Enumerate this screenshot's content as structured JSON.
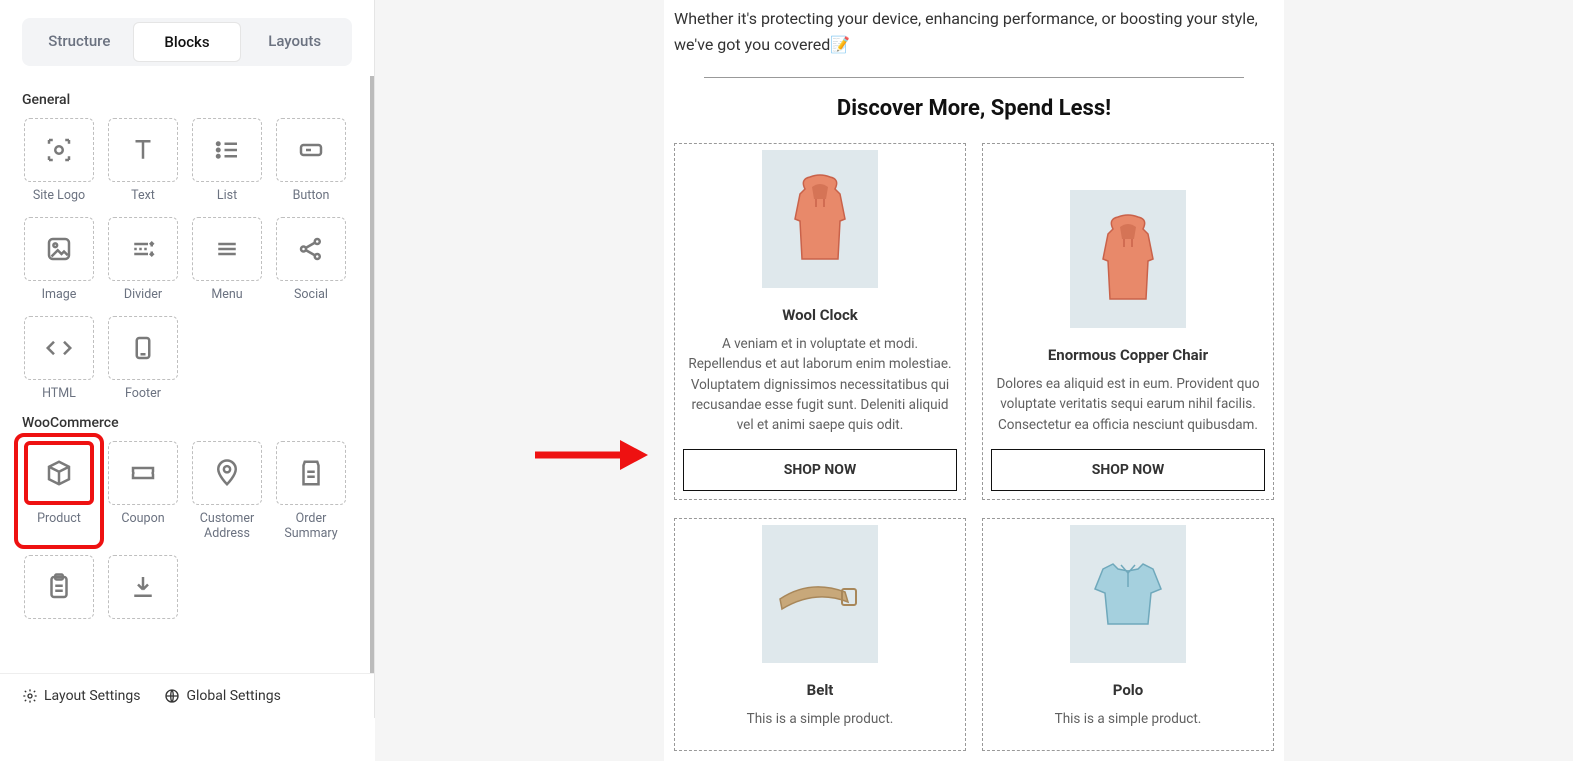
{
  "sidebar": {
    "tabs": {
      "structure": "Structure",
      "blocks": "Blocks",
      "layouts": "Layouts"
    },
    "sections": {
      "general": "General",
      "woocommerce": "WooCommerce"
    },
    "blocks": {
      "site_logo": "Site Logo",
      "text": "Text",
      "list": "List",
      "button": "Button",
      "image": "Image",
      "divider": "Divider",
      "menu": "Menu",
      "social": "Social",
      "html": "HTML",
      "footer": "Footer",
      "product": "Product",
      "coupon": "Coupon",
      "customer_address": "Customer Address",
      "order_summary": "Order Summary"
    },
    "bottom": {
      "layout": "Layout Settings",
      "global": "Global Settings"
    }
  },
  "email": {
    "intro": "Whether it's protecting your device, enhancing performance, or boosting your style, we've got you covered📝",
    "headline": "Discover More, Spend Less!",
    "shop_now": "SHOP NOW",
    "products": [
      {
        "title": "Wool Clock",
        "desc": "A veniam et in voluptate et modi. Repellendus et aut laborum enim molestiae. Voluptatem dignissimos necessitatibus qui recusandae esse fugit sunt. Deleniti aliquid vel et animi saepe quis odit.",
        "img": "hoodie"
      },
      {
        "title": "Enormous Copper Chair",
        "desc": "Dolores ea aliquid est in eum. Provident quo voluptate veritatis sequi earum nihil facilis. Consectetur ea officia nesciunt quibusdam.",
        "img": "hoodie"
      },
      {
        "title": "Belt",
        "desc": "This is a simple product.",
        "img": "belt"
      },
      {
        "title": "Polo",
        "desc": "This is a simple product.",
        "img": "polo"
      }
    ]
  }
}
